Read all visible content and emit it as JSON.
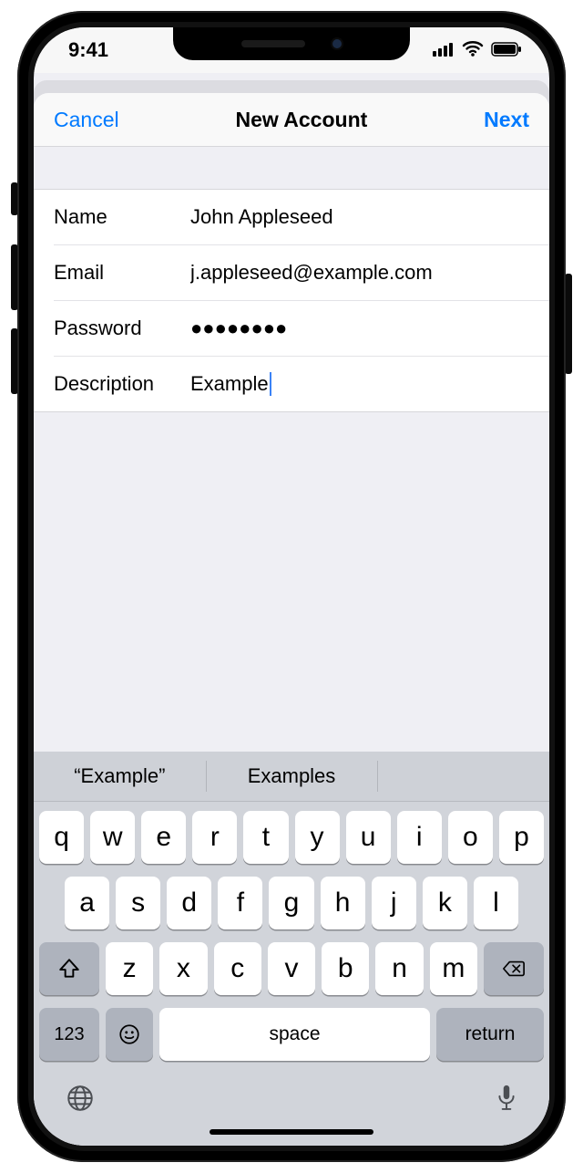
{
  "statusbar": {
    "time": "9:41"
  },
  "nav": {
    "cancel": "Cancel",
    "title": "New Account",
    "next": "Next"
  },
  "form": {
    "name": {
      "label": "Name",
      "value": "John Appleseed"
    },
    "email": {
      "label": "Email",
      "value": "j.appleseed@example.com"
    },
    "password": {
      "label": "Password",
      "value": "●●●●●●●●"
    },
    "description": {
      "label": "Description",
      "value": "Example"
    }
  },
  "predictive": {
    "opt1": "“Example”",
    "opt2": "Examples",
    "opt3": ""
  },
  "keyboard": {
    "row1": [
      "q",
      "w",
      "e",
      "r",
      "t",
      "y",
      "u",
      "i",
      "o",
      "p"
    ],
    "row2": [
      "a",
      "s",
      "d",
      "f",
      "g",
      "h",
      "j",
      "k",
      "l"
    ],
    "row3": [
      "z",
      "x",
      "c",
      "v",
      "b",
      "n",
      "m"
    ],
    "k123": "123",
    "space": "space",
    "return": "return"
  }
}
